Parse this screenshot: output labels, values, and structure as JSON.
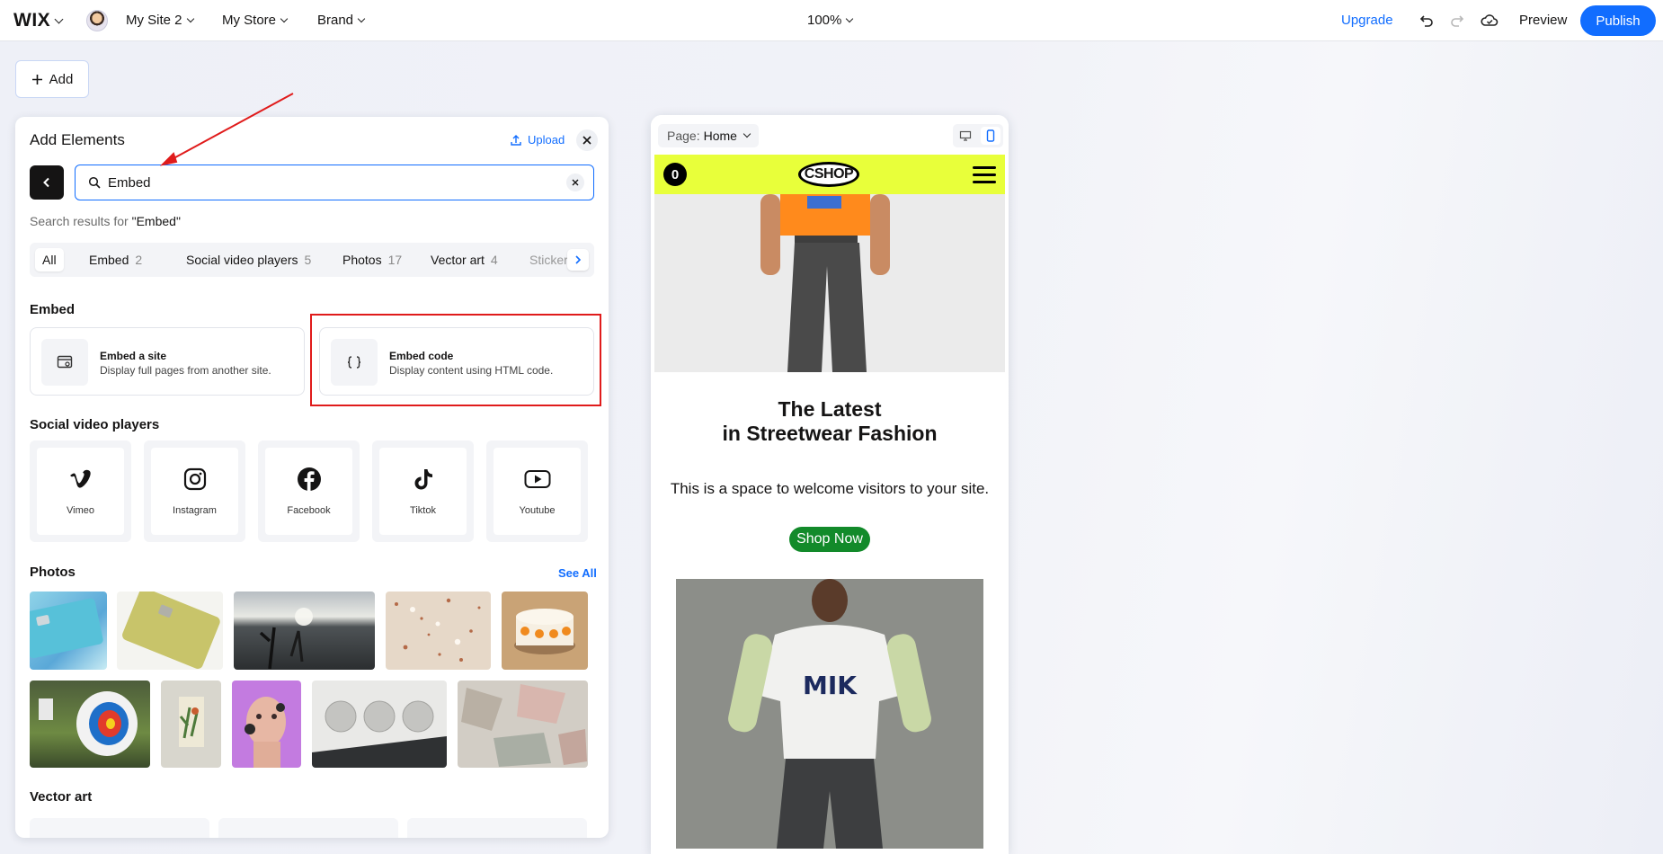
{
  "topbar": {
    "logo": "WIX",
    "menus": [
      "My Site 2",
      "My Store",
      "Brand"
    ],
    "zoom": "100%",
    "upgrade": "Upgrade",
    "preview": "Preview",
    "publish": "Publish"
  },
  "add_button": "Add",
  "panel": {
    "title": "Add Elements",
    "upload": "Upload",
    "search": {
      "value": "Embed",
      "placeholder": "Search"
    },
    "results_prefix": "Search results for ",
    "results_query": "\"Embed\"",
    "filters": [
      {
        "label": "All",
        "count": ""
      },
      {
        "label": "Embed",
        "count": "2"
      },
      {
        "label": "Social video players",
        "count": "5"
      },
      {
        "label": "Photos",
        "count": "17"
      },
      {
        "label": "Vector art",
        "count": "4"
      },
      {
        "label": "Stickers",
        "count": ""
      }
    ],
    "embed_section": "Embed",
    "embed_items": [
      {
        "name": "Embed a site",
        "desc": "Display full pages from another site.",
        "icon": "browser-icon"
      },
      {
        "name": "Embed code",
        "desc": "Display content using HTML code.",
        "icon": "code-braces-icon"
      }
    ],
    "social_section": "Social video players",
    "social_items": [
      {
        "label": "Vimeo",
        "icon": "vimeo-icon"
      },
      {
        "label": "Instagram",
        "icon": "instagram-icon"
      },
      {
        "label": "Facebook",
        "icon": "facebook-icon"
      },
      {
        "label": "Tiktok",
        "icon": "tiktok-icon"
      },
      {
        "label": "Youtube",
        "icon": "youtube-icon"
      }
    ],
    "photos_section": "Photos",
    "see_all": "See All",
    "vector_section": "Vector art"
  },
  "canvas": {
    "page_label": "Page:",
    "page_name": "Home",
    "cart_count": "0",
    "logo_text": "CSHOP",
    "headline_line1": "The Latest",
    "headline_line2": "in Streetwear Fashion",
    "welcome": "This is a space to welcome visitors to your site.",
    "cta": "Shop Now"
  },
  "colors": {
    "accent": "#116dff",
    "highlight_box": "#e01b1b",
    "site_header": "#e8ff3a",
    "cta": "#128a2a"
  }
}
